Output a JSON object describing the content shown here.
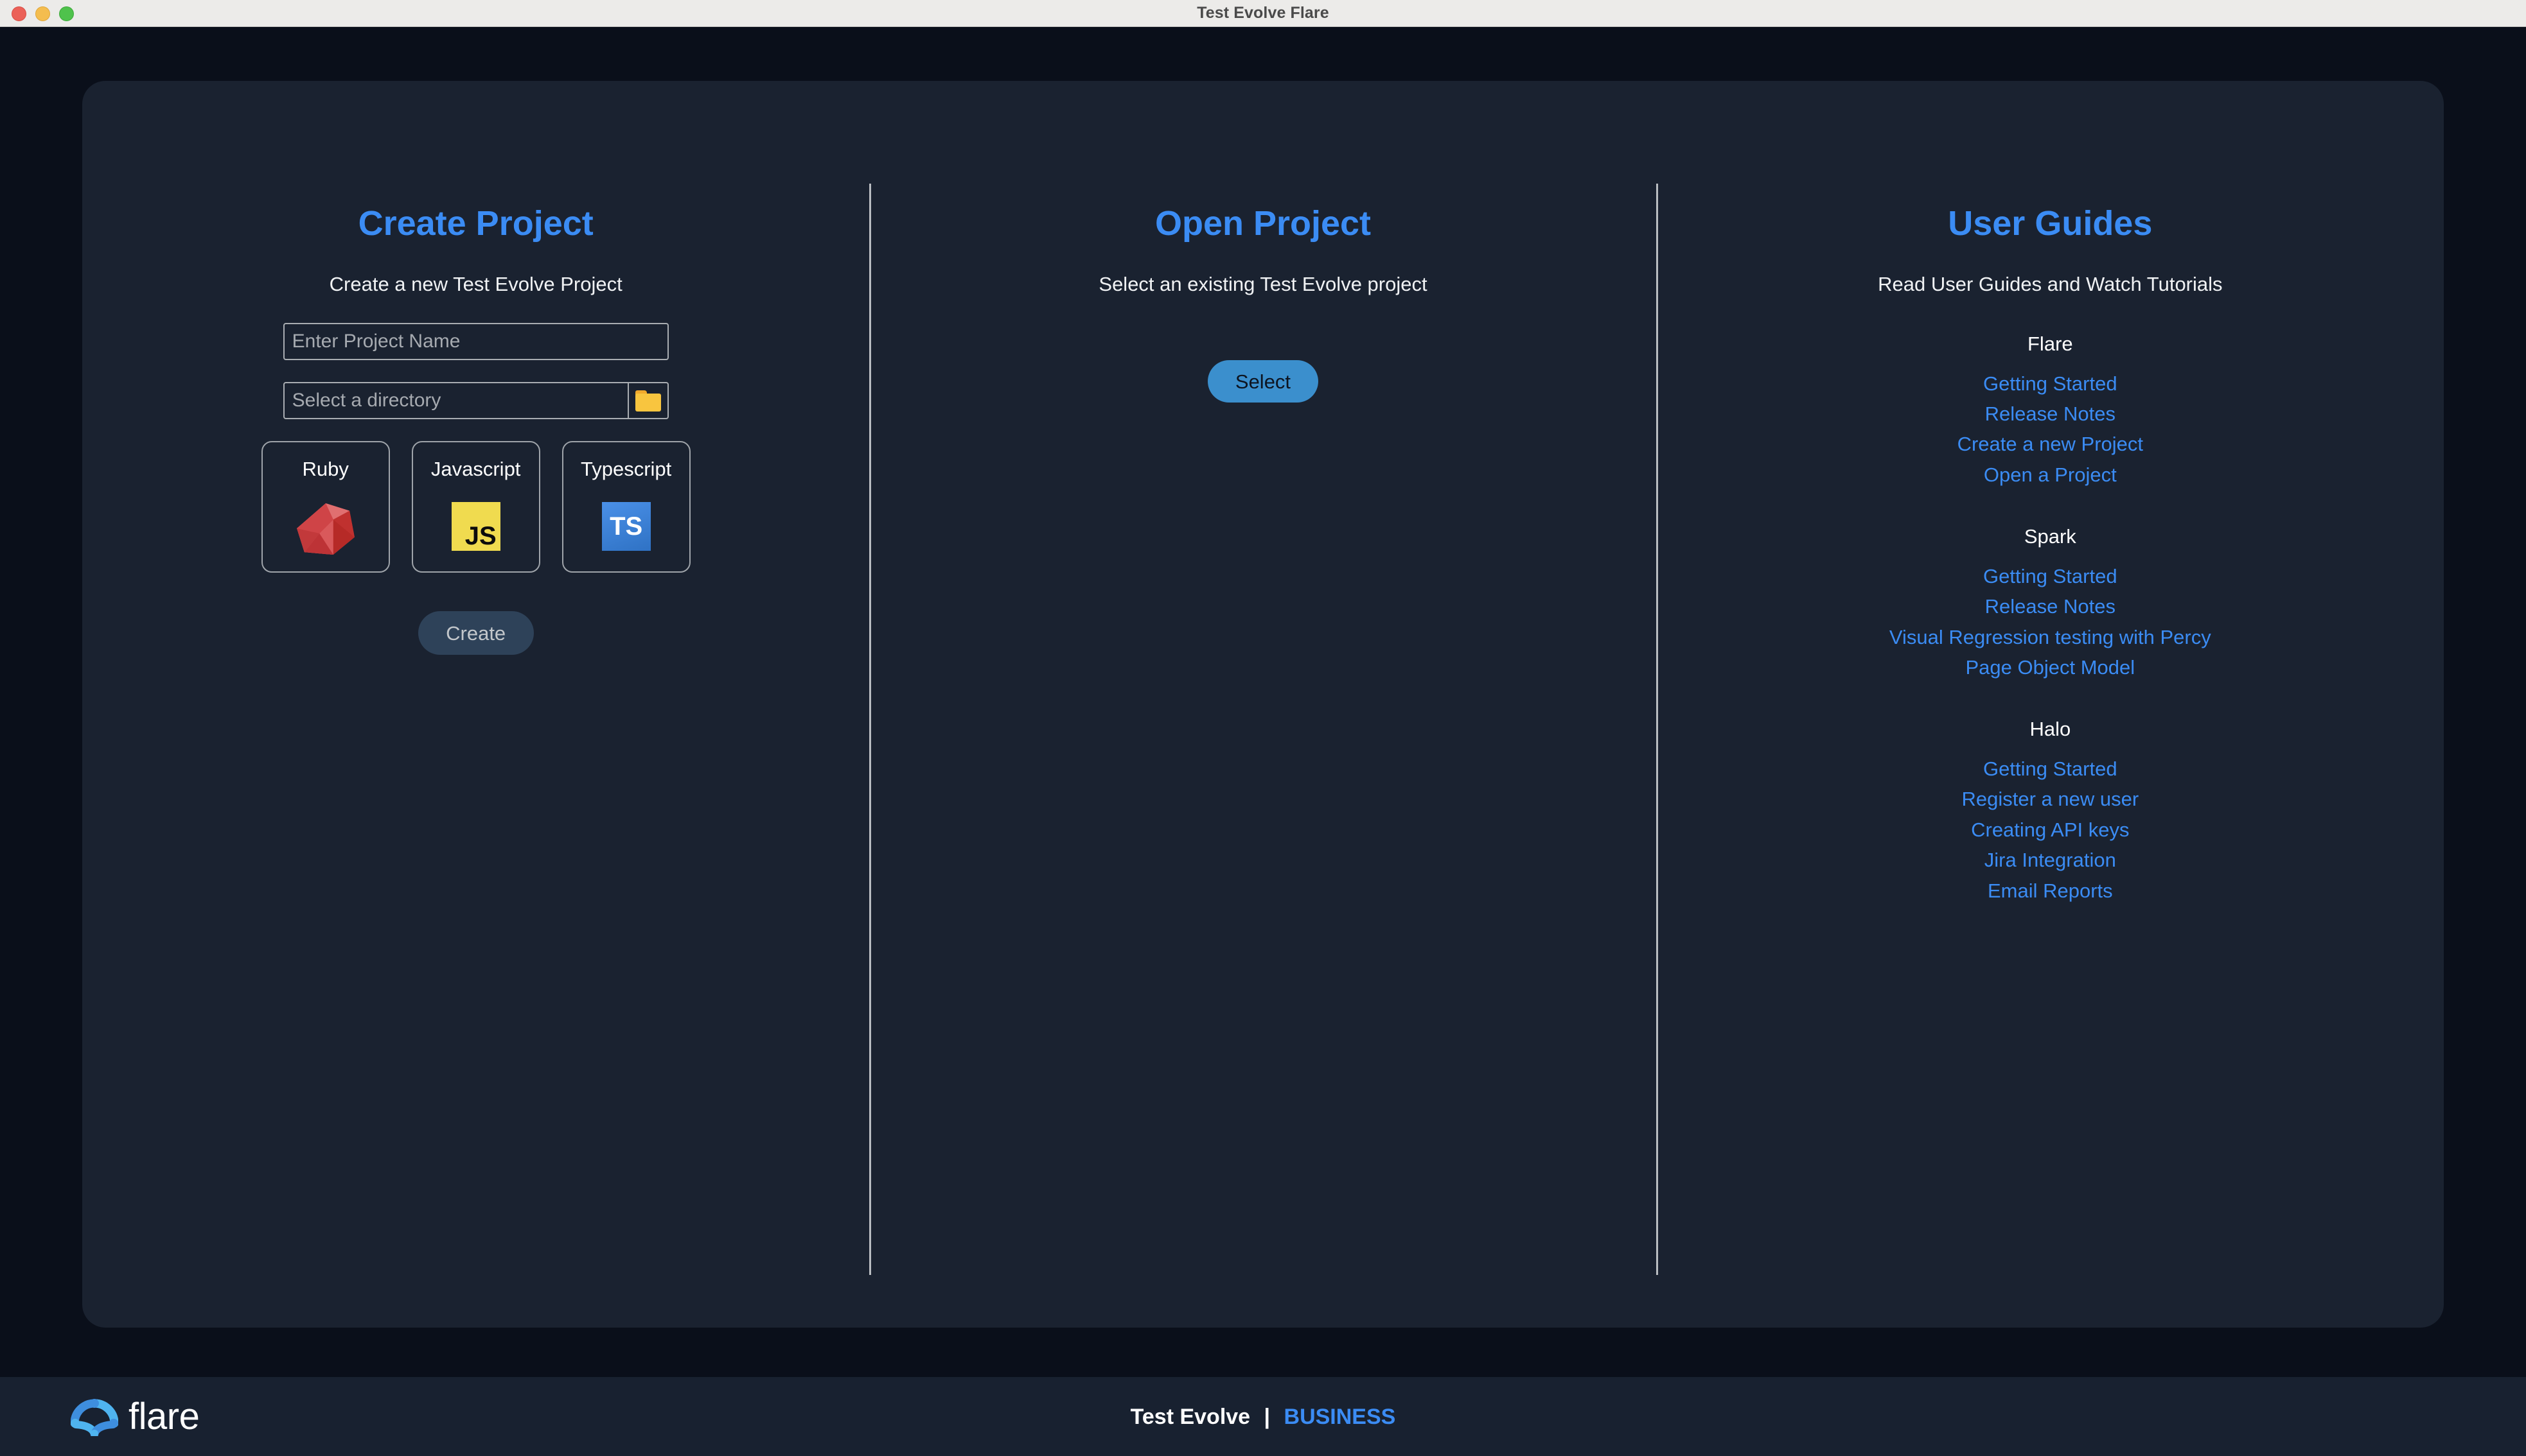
{
  "window": {
    "title": "Test Evolve Flare",
    "traffic_lights": [
      "close-red",
      "minimize-yellow",
      "maximize-green"
    ]
  },
  "create_project": {
    "title": "Create Project",
    "subtitle": "Create a new Test Evolve Project",
    "name_placeholder": "Enter Project Name",
    "name_value": "",
    "directory_placeholder": "Select a directory",
    "directory_value": "",
    "folder_icon": "folder-icon",
    "languages": [
      {
        "label": "Ruby",
        "icon": "ruby-gem-icon"
      },
      {
        "label": "Javascript",
        "icon": "javascript-icon",
        "glyph": "JS"
      },
      {
        "label": "Typescript",
        "icon": "typescript-icon",
        "glyph": "TS"
      }
    ],
    "create_label": "Create"
  },
  "open_project": {
    "title": "Open Project",
    "subtitle": "Select an existing Test Evolve project",
    "select_label": "Select"
  },
  "user_guides": {
    "title": "User Guides",
    "subtitle": "Read User Guides and Watch Tutorials",
    "groups": [
      {
        "heading": "Flare",
        "links": [
          "Getting Started",
          "Release Notes",
          "Create a new Project",
          "Open a Project"
        ]
      },
      {
        "heading": "Spark",
        "links": [
          "Getting Started",
          "Release Notes",
          "Visual Regression testing with Percy",
          "Page Object Model"
        ]
      },
      {
        "heading": "Halo",
        "links": [
          "Getting Started",
          "Register a new user",
          "Creating API keys",
          "Jira Integration",
          "Email Reports"
        ]
      }
    ]
  },
  "footer": {
    "logo_icon": "flare-logo-icon",
    "logo_text": "flare",
    "product": "Test Evolve",
    "separator": "|",
    "tier": "BUSINESS"
  },
  "colors": {
    "accent_blue": "#3b8cf4",
    "page_background": "#0a0f1a",
    "card_background": "#1a2230",
    "footer_background": "#182130",
    "select_button": "#3b8fcd",
    "create_button": "#2e4259",
    "folder_yellow": "#f8c53f",
    "js_yellow": "#f0db4f",
    "ts_blue": "#3178c6",
    "ruby_red": "#cc342d"
  }
}
